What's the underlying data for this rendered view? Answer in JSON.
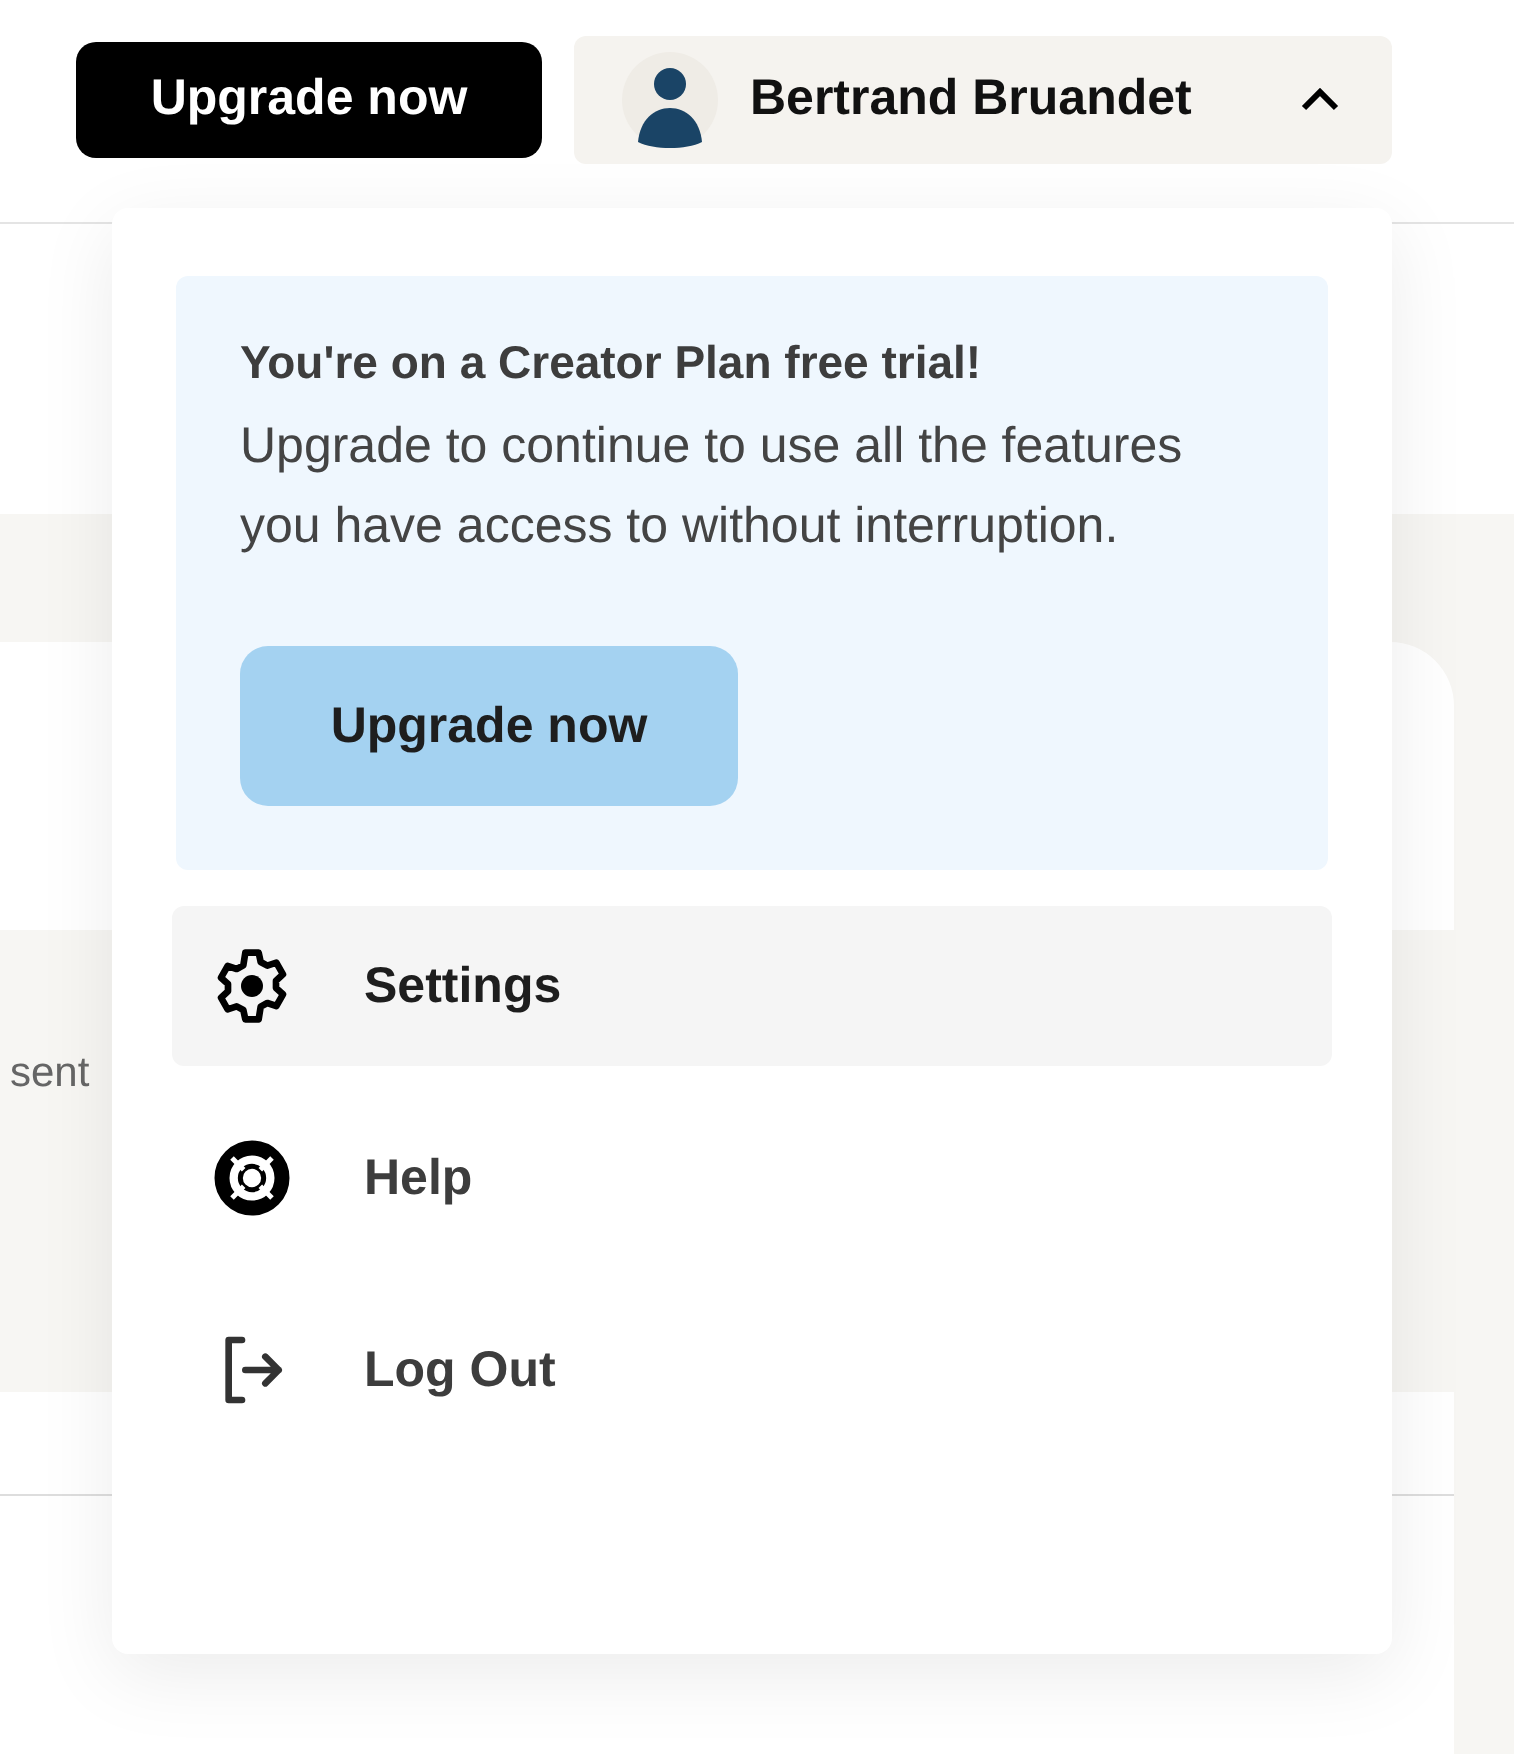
{
  "header": {
    "upgrade_button": "Upgrade now",
    "user": {
      "name": "Bertrand Bruandet",
      "expanded": true
    }
  },
  "background": {
    "snippet": "sent"
  },
  "menu": {
    "promo": {
      "title": "You're on a Creator Plan free trial!",
      "body": "Upgrade to continue to use all the features you have access to without interruption.",
      "button": "Upgrade now"
    },
    "items": [
      {
        "label": "Settings",
        "kind": "settings",
        "selected": true
      },
      {
        "label": "Help",
        "kind": "help",
        "selected": false
      },
      {
        "label": "Log Out",
        "kind": "logout",
        "selected": false
      }
    ]
  }
}
